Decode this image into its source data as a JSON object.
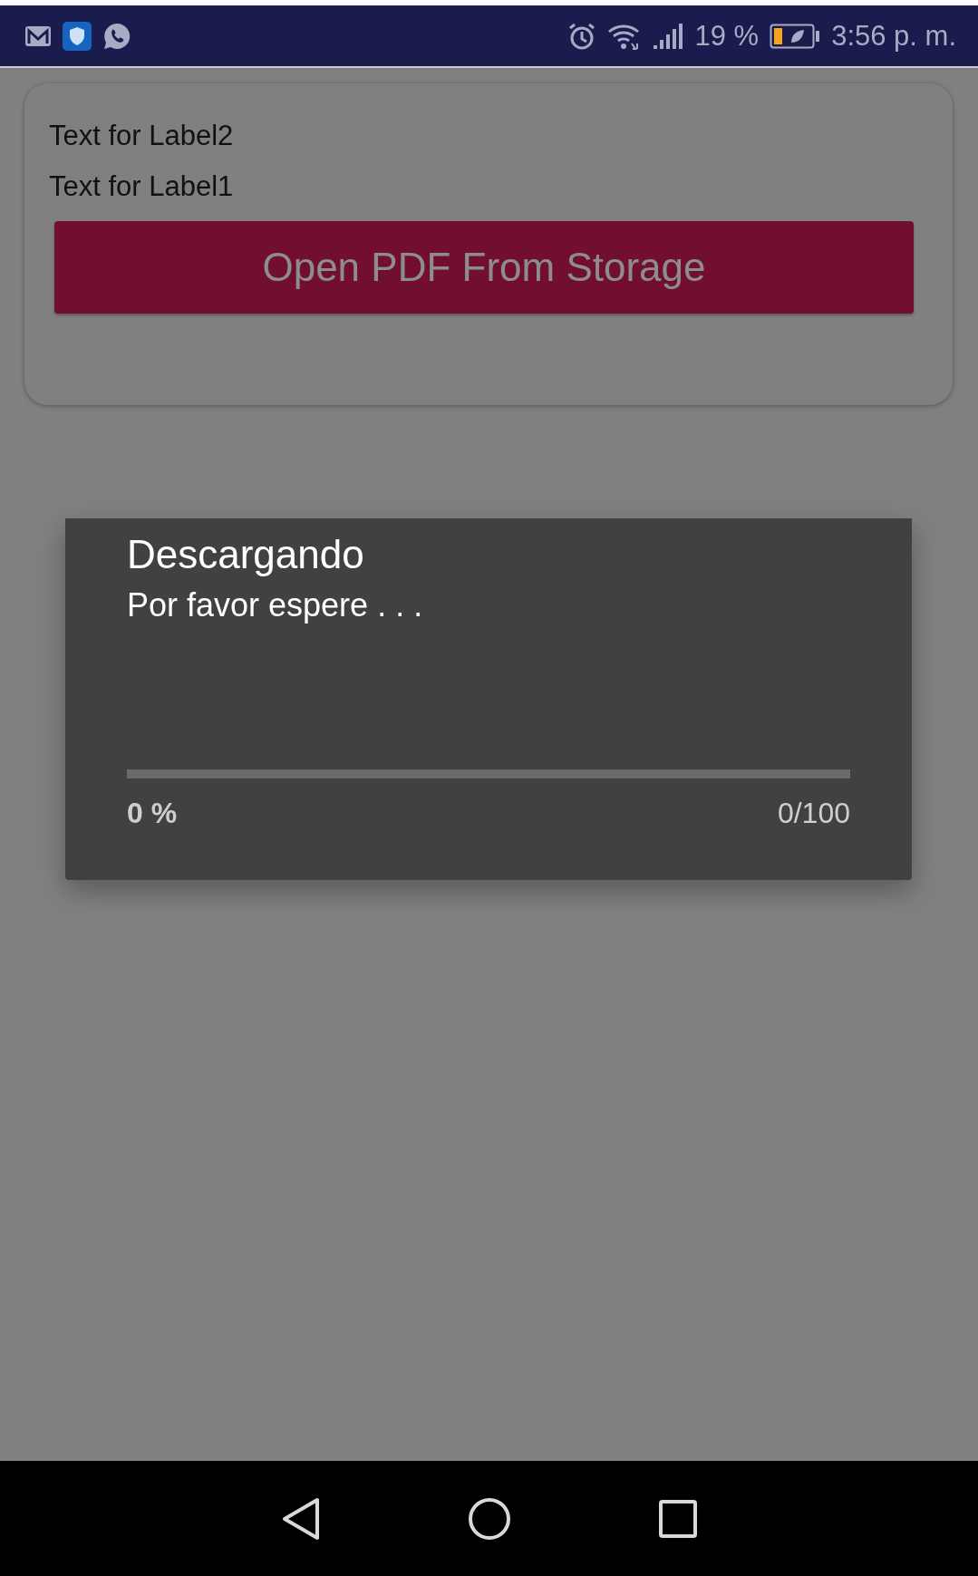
{
  "status_bar": {
    "battery_percent": "19 %",
    "time": "3:56 p. m."
  },
  "labels": [
    "Text for Label2",
    "Text for Label1"
  ],
  "button": {
    "label": "Open PDF From Storage"
  },
  "dialog": {
    "title": "Descargando",
    "message": "Por favor espere . . .",
    "progress": {
      "level": 0,
      "percent": "0 %",
      "count": "0/100"
    }
  }
}
